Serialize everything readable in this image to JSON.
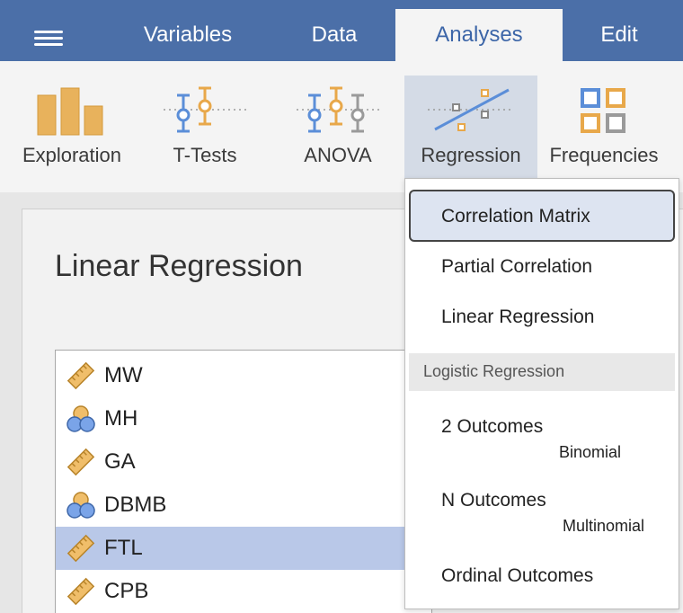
{
  "menubar": {
    "tabs": [
      {
        "label": "Variables"
      },
      {
        "label": "Data"
      },
      {
        "label": "Analyses"
      },
      {
        "label": "Edit"
      }
    ],
    "active_tab": "Analyses"
  },
  "ribbon": {
    "buttons": [
      {
        "label": "Exploration",
        "icon": "bar-chart-icon"
      },
      {
        "label": "T-Tests",
        "icon": "t-test-icon"
      },
      {
        "label": "ANOVA",
        "icon": "anova-icon"
      },
      {
        "label": "Regression",
        "icon": "regression-icon"
      },
      {
        "label": "Frequencies",
        "icon": "frequencies-icon"
      }
    ],
    "active_button": "Regression"
  },
  "panel": {
    "title": "Linear Regression",
    "variables": [
      {
        "name": "MW",
        "type": "continuous"
      },
      {
        "name": "MH",
        "type": "nominal"
      },
      {
        "name": "GA",
        "type": "continuous"
      },
      {
        "name": "DBMB",
        "type": "nominal"
      },
      {
        "name": "FTL",
        "type": "continuous",
        "selected": true
      },
      {
        "name": "CPB",
        "type": "continuous"
      }
    ]
  },
  "dropdown": {
    "items": [
      {
        "label": "Correlation Matrix"
      },
      {
        "label": "Partial Correlation"
      },
      {
        "label": "Linear Regression"
      }
    ],
    "section_header": "Logistic Regression",
    "logistic_items": [
      {
        "label": "2 Outcomes",
        "sublabel": "Binomial"
      },
      {
        "label": "N Outcomes",
        "sublabel": "Multinomial"
      },
      {
        "label": "Ordinal Outcomes"
      }
    ]
  },
  "colors": {
    "menubar": "#4b6fa8",
    "accent_blue": "#3d66a8",
    "accent_orange": "#e8a84a",
    "selected_row": "#b9c8e8"
  }
}
